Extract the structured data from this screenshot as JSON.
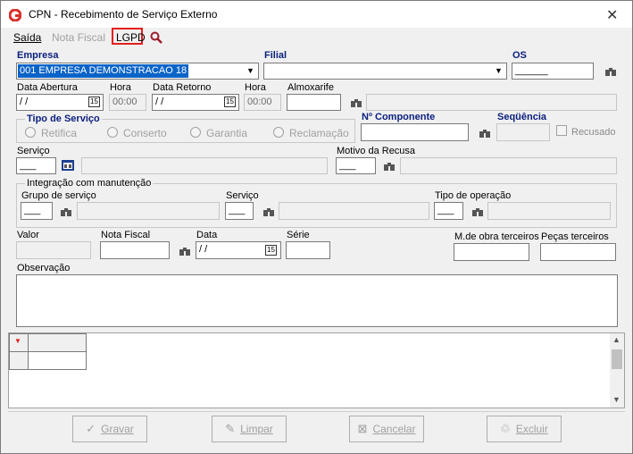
{
  "window": {
    "title": "CPN - Recebimento de Serviço Externo"
  },
  "menu": {
    "saida": "Saída",
    "nota_fiscal": "Nota Fiscal",
    "lgpd": "LGPD"
  },
  "empresa": {
    "label": "Empresa",
    "value": "001 EMPRESA DEMONSTRACAO 18"
  },
  "filial": {
    "label": "Filial",
    "value": ""
  },
  "os": {
    "label": "OS",
    "value": "______"
  },
  "data_abertura": {
    "label": "Data Abertura",
    "value": " / /",
    "cal": "15"
  },
  "hora1": {
    "label": "Hora",
    "value": "00:00"
  },
  "data_retorno": {
    "label": "Data Retorno",
    "value": " / /",
    "cal": "15"
  },
  "hora2": {
    "label": "Hora",
    "value": "00:00"
  },
  "almoxarife": {
    "label": "Almoxarife",
    "value": ""
  },
  "tipo_servico": {
    "label": "Tipo de Serviço",
    "options": [
      "Retifica",
      "Conserto",
      "Garantia",
      "Reclamação"
    ]
  },
  "componente": {
    "label": "Nº  Componente",
    "value": ""
  },
  "sequencia": {
    "label": "Seqüência",
    "value": ""
  },
  "recusado": {
    "label": "Recusado"
  },
  "servico": {
    "label": "Serviço",
    "value": "___"
  },
  "motivo_recusa": {
    "label": "Motivo da Recusa",
    "value": "___"
  },
  "integracao": {
    "label": "Integração com manutenção",
    "grupo_servico": {
      "label": "Grupo de serviço",
      "value": "___"
    },
    "servico": {
      "label": "Serviço",
      "value": "___"
    },
    "tipo_operacao": {
      "label": "Tipo de operação",
      "value": "___"
    }
  },
  "valor": {
    "label": "Valor",
    "value": ""
  },
  "nota_fiscal": {
    "label": "Nota Fiscal",
    "value": ""
  },
  "data_nf": {
    "label": "Data",
    "value": " / /",
    "cal": "15"
  },
  "serie": {
    "label": "Série",
    "value": ""
  },
  "mao_obra": {
    "label": "M.de obra terceiros",
    "value": ""
  },
  "pecas": {
    "label": "Peças terceiros",
    "value": ""
  },
  "observacao": {
    "label": "Observação",
    "value": ""
  },
  "buttons": {
    "gravar": "Gravar",
    "limpar": "Limpar",
    "cancelar": "Cancelar",
    "excluir": "Excluir"
  },
  "colors": {
    "accent": "#0a1f7d",
    "selection": "#0a64c8",
    "lgpd_border": "#e41e1e",
    "brand_icon": "#d9302a"
  },
  "icons": [
    "app-logo-icon",
    "close-icon",
    "search-icon",
    "binoculars-icon",
    "calendar-icon",
    "checkmark-icon",
    "eraser-icon",
    "cancel-icon",
    "trash-icon"
  ]
}
